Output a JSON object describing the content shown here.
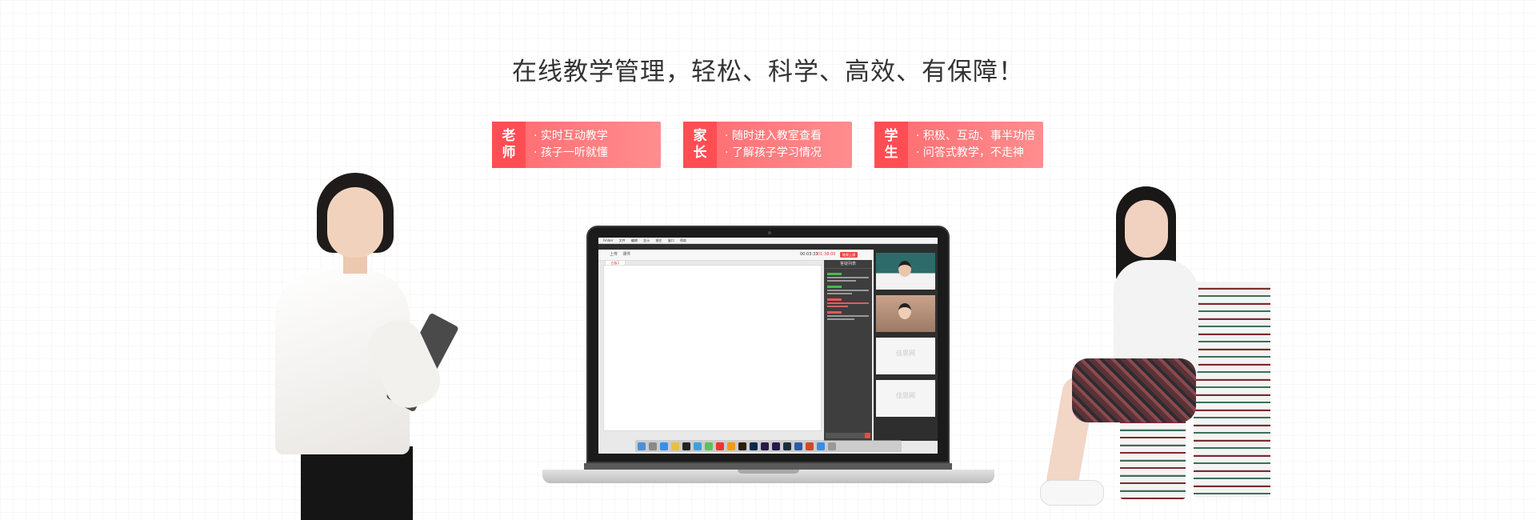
{
  "headline": "在线教学管理，轻松、科学、高效、有保障！",
  "cards": [
    {
      "role_line1": "老",
      "role_line2": "师",
      "point1": "实时互动教学",
      "point2": "孩子一听就懂"
    },
    {
      "role_line1": "家",
      "role_line2": "长",
      "point1": "随时进入教室查看",
      "point2": "了解孩子学习情况"
    },
    {
      "role_line1": "学",
      "role_line2": "生",
      "point1": "积极、互动、事半功倍",
      "point2": "问答式教学，不走神"
    }
  ],
  "laptop": {
    "menubar": [
      "Finder",
      "文件",
      "编辑",
      "显示",
      "前往",
      "窗口",
      "帮助"
    ],
    "timer": "00:03:33",
    "timer_red": "01:38:00",
    "end_button": "结束上课",
    "board_tab": "白板1",
    "qa_title": "答疑列表",
    "toolbar_items": [
      "上传",
      "课件"
    ],
    "placeholder_brand": "佳思网"
  },
  "colors": {
    "accent": "#ff4d54",
    "card_gradient_start": "#ff6a6e",
    "card_gradient_end": "#ff8d8f"
  }
}
